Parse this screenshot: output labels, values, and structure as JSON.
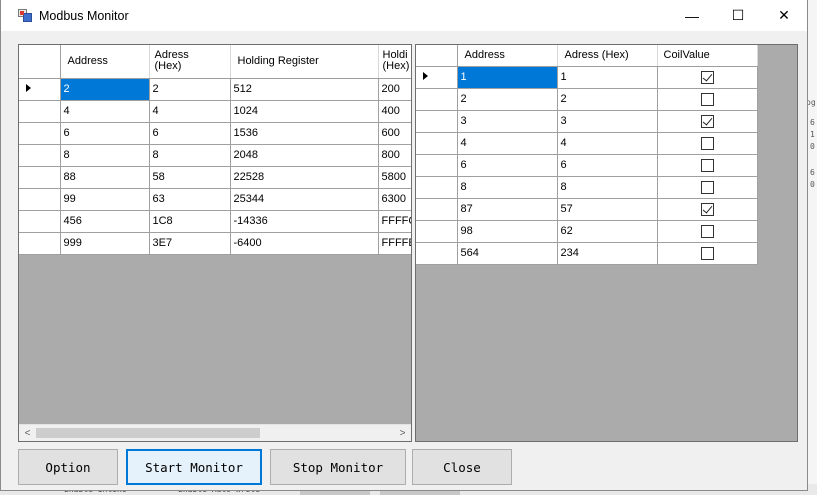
{
  "window": {
    "title": "Modbus Monitor",
    "minimize_glyph": "—",
    "maximize_glyph": "☐",
    "close_glyph": "✕"
  },
  "register_grid": {
    "columns": [
      "Address",
      "Adress\n(Hex)",
      "Holding Register",
      "Holdi\n(Hex)"
    ],
    "rows": [
      [
        "2",
        "2",
        "512",
        "200"
      ],
      [
        "4",
        "4",
        "1024",
        "400"
      ],
      [
        "6",
        "6",
        "1536",
        "600"
      ],
      [
        "8",
        "8",
        "2048",
        "800"
      ],
      [
        "88",
        "58",
        "22528",
        "5800"
      ],
      [
        "99",
        "63",
        "25344",
        "6300"
      ],
      [
        "456",
        "1C8",
        "-14336",
        "FFFFC"
      ],
      [
        "999",
        "3E7",
        "-6400",
        "FFFFE"
      ]
    ],
    "current_row": 0,
    "scroll_left_glyph": "<",
    "scroll_right_glyph": ">"
  },
  "coil_grid": {
    "columns": [
      "Address",
      "Adress (Hex)",
      "CoilValue"
    ],
    "rows": [
      {
        "address": "1",
        "hex": "1",
        "coil": true
      },
      {
        "address": "2",
        "hex": "2",
        "coil": false
      },
      {
        "address": "3",
        "hex": "3",
        "coil": true
      },
      {
        "address": "4",
        "hex": "4",
        "coil": false
      },
      {
        "address": "6",
        "hex": "6",
        "coil": false
      },
      {
        "address": "8",
        "hex": "8",
        "coil": false
      },
      {
        "address": "87",
        "hex": "57",
        "coil": true
      },
      {
        "address": "98",
        "hex": "62",
        "coil": false
      },
      {
        "address": "564",
        "hex": "234",
        "coil": false
      }
    ],
    "current_row": 0
  },
  "buttons": {
    "option": "Option",
    "start_monitor": "Start Monitor",
    "stop_monitor": "Stop Monitor",
    "close": "Close"
  },
  "background": {
    "right_glyphs": [
      "pg",
      "6",
      "1",
      "0",
      "6",
      "0"
    ],
    "bottom_left": "Enable Inline",
    "bottom_mid": "Enable Auto Write"
  },
  "colors": {
    "selection": "#0078d7",
    "grid_background": "#ababab",
    "focus_border": "#0078d7"
  }
}
